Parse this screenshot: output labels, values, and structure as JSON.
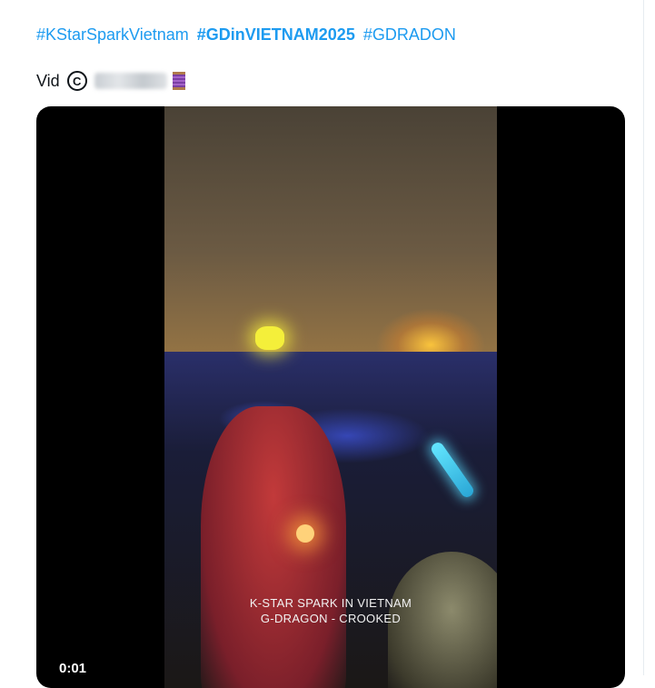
{
  "tweet": {
    "hashtags": [
      {
        "text": "#KStarSparkVietnam",
        "bold": false
      },
      {
        "text": "#GDinVIETNAM2025",
        "bold": true
      },
      {
        "text": "#GDRADON",
        "bold": false
      }
    ],
    "caption": {
      "prefix": "Vid",
      "copyright_symbol": "C"
    }
  },
  "video": {
    "overlay_line1": "K-STAR SPARK IN VIETNAM",
    "overlay_line2": "G-DRAGON - CROOKED",
    "timestamp": "0:01"
  },
  "colors": {
    "hashtag": "#1d9bf0",
    "text": "#0f1419",
    "player_bg": "#000000"
  }
}
